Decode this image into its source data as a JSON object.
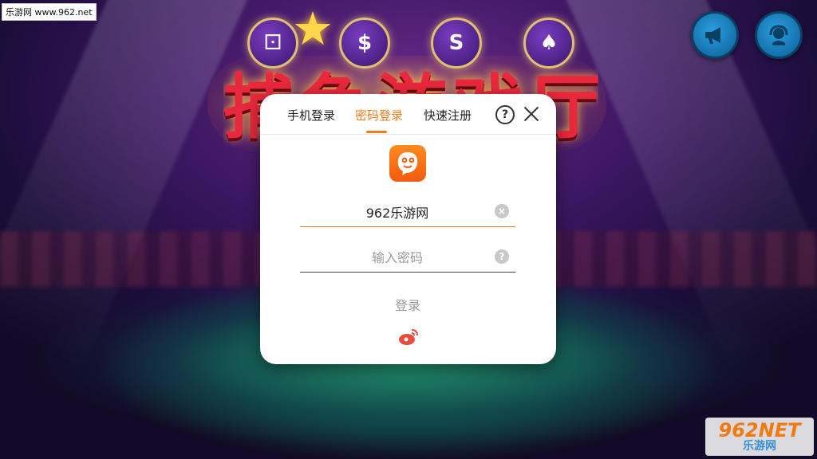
{
  "watermark": {
    "top_text": "乐游网 www.962.net",
    "bottom_number": "962NET",
    "bottom_text": "乐游网"
  },
  "background": {
    "title": "捕鱼游戏厅",
    "badges": [
      "⚀",
      "$",
      "S",
      "♠"
    ]
  },
  "corner": {
    "left_icon": "megaphone-icon",
    "right_icon": "support-headset-icon"
  },
  "dialog": {
    "tabs": [
      {
        "label": "手机登录",
        "active": false
      },
      {
        "label": "密码登录",
        "active": true
      },
      {
        "label": "快速注册",
        "active": false
      }
    ],
    "help_label": "?",
    "username": {
      "value": "962乐游网",
      "clear_icon": "×"
    },
    "password": {
      "placeholder": "输入密码",
      "help_icon": "?"
    },
    "login_label": "登录",
    "accent_color": "#f07a20"
  }
}
